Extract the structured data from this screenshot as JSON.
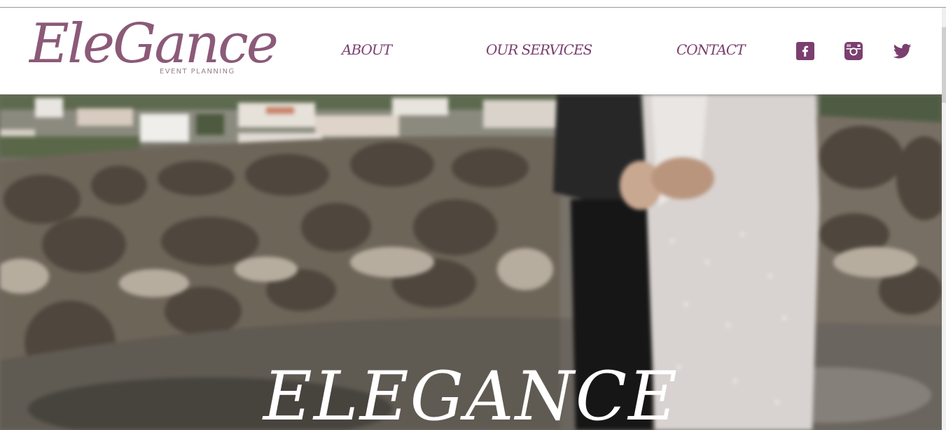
{
  "brand": {
    "logo_script": "EleGance",
    "logo_tagline": "EVENT PLANNING",
    "color": "#8b5a78"
  },
  "nav": {
    "about": "ABOUT",
    "services": "OUR SERVICES",
    "contact": "CONTACT",
    "color": "#7a3f6e"
  },
  "social": {
    "icons": [
      "facebook-icon",
      "instagram-icon",
      "twitter-icon"
    ]
  },
  "hero": {
    "title": "ELEGANCE"
  }
}
